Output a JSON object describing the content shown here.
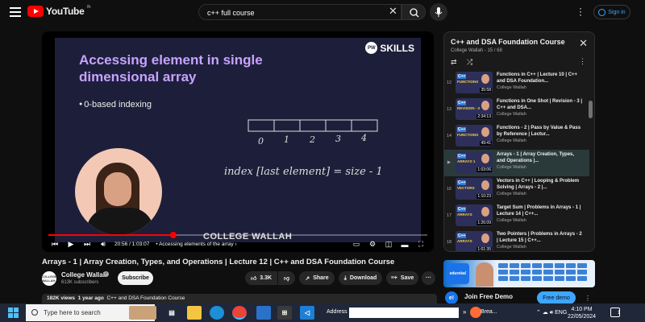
{
  "header": {
    "logo_text": "YouTube",
    "country": "IN",
    "search_value": "c++ full course",
    "signin_label": "Sign in"
  },
  "video": {
    "slide_title": "Accessing element in single dimensional array",
    "slide_brand": "SKILLS",
    "bullet": "0-based indexing",
    "array_indices": [
      "0",
      "1",
      "2",
      "3",
      "4"
    ],
    "handwriting": "index [last element] = size - 1",
    "watermark": "COLLEGE WALLAH",
    "timestamp": "20:56 / 1:03:07",
    "chapter": "• Accessing elements of the array ›",
    "progress_fraction": 0.33
  },
  "meta": {
    "title": "Arrays - 1 | Array Creation, Types, and Operations | Lecture 12 | C++ and DSA Foundation Course",
    "channel": "College Wallah",
    "channel_avatar_text": "COLLEGE WALLAH",
    "subscribers": "613K subscribers",
    "subscribe_label": "Subscribe",
    "likes": "3.3K",
    "share_label": "Share",
    "download_label": "Download",
    "save_label": "Save",
    "views": "182K views",
    "age": "1 year ago",
    "desc_snippet": "C++ and DSA Foundation Course"
  },
  "playlist": {
    "title": "C++ and DSA Foundation Course",
    "subtitle": "College Wallah - 15 / 68",
    "items": [
      {
        "index": "12",
        "name": "Functions in C++ | Lecture 10 | C++ and DSA Foundation...",
        "channel": "College Wallah",
        "duration": "35:58",
        "tag1": "C++",
        "tag2": "FUNCTIONS"
      },
      {
        "index": "13",
        "name": "Functions in One Shot | Revision - 3 | C++ and DSA...",
        "channel": "College Wallah",
        "duration": "2:34:13",
        "tag1": "C++",
        "tag2": "REVISION - 3"
      },
      {
        "index": "14",
        "name": "Functions - 2 | Pass by Value & Pass by Reference | Lectur...",
        "channel": "College Wallah",
        "duration": "49:41",
        "tag1": "C++",
        "tag2": "FUNCTIONS"
      },
      {
        "index": "▶",
        "name": "Arrays - 1 | Array Creation, Types, and Operations |...",
        "channel": "College Wallah",
        "duration": "1:03:06",
        "tag1": "C++",
        "tag2": "ARRAYS 1"
      },
      {
        "index": "16",
        "name": "Vectors in C++ | Looping & Problem Solving | Arrays - 2 |...",
        "channel": "College Wallah",
        "duration": "1:10:23",
        "tag1": "C++",
        "tag2": "VECTORS"
      },
      {
        "index": "17",
        "name": "Target Sum | Problems in Arrays - 1 | Lecture 14 | C++...",
        "channel": "College Wallah",
        "duration": "1:26:09",
        "tag1": "C++",
        "tag2": "ARRAYS"
      },
      {
        "index": "18",
        "name": "Two Pointers | Problems in Arrays - 2 | Lecture 15 | C++...",
        "channel": "College Wallah",
        "duration": "1:01:35",
        "tag1": "C++",
        "tag2": "ARRAYS"
      }
    ],
    "current_index": 3
  },
  "ad": {
    "brand": "edureka!",
    "title": "Join Free Demo",
    "cta": "Free demo",
    "logo_letter": "e!"
  },
  "taskbar": {
    "search_placeholder": "Type here to search",
    "address_label": "Address",
    "weather_text": "Brea...",
    "time": "4:10 PM",
    "date": "22/05/2024",
    "notification_count": "1",
    "tray_lang": "ENG"
  },
  "colors": {
    "accent_red": "#ff0000",
    "link_blue": "#3ea6ff",
    "slide_title": "#c7a3ff"
  }
}
